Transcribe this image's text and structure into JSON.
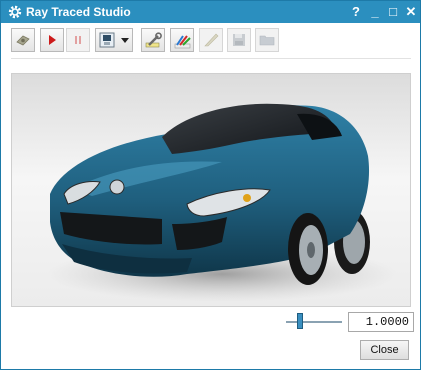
{
  "window": {
    "title": "Ray Traced Studio"
  },
  "titlebar_controls": {
    "help": "?",
    "minimize": "_",
    "maximize": "□",
    "close": "✕"
  },
  "toolbar": {
    "buttons": [
      {
        "name": "studio-settings-button",
        "icon": "camera-icon",
        "enabled": true
      },
      {
        "name": "start-render-button",
        "icon": "play-icon",
        "enabled": true
      },
      {
        "name": "pause-render-button",
        "icon": "pause-icon",
        "enabled": false
      },
      {
        "name": "display-mode-dropdown",
        "icon": "monitor-icon",
        "enabled": true
      },
      {
        "name": "edit-scene-button",
        "icon": "wrench-icon",
        "enabled": true
      },
      {
        "name": "color-settings-button",
        "icon": "color-pencils-icon",
        "enabled": true
      },
      {
        "name": "save-image-button",
        "icon": "image-icon",
        "enabled": false
      },
      {
        "name": "save-button",
        "icon": "floppy-icon",
        "enabled": false
      },
      {
        "name": "open-folder-button",
        "icon": "folder-icon",
        "enabled": false
      }
    ]
  },
  "viewport": {
    "subject": "blue sports car render"
  },
  "zoom": {
    "value": "1.0000",
    "slider_fraction": 0.25
  },
  "actions": {
    "close_label": "Close"
  },
  "colors": {
    "titlebar": "#2b8fbf",
    "car_body": "#1f5f7e"
  }
}
